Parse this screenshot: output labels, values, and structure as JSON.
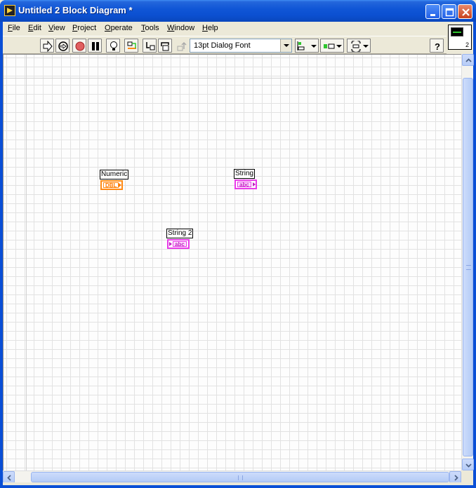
{
  "window": {
    "title": "Untitled 2 Block Diagram *",
    "controls": [
      "minimize",
      "maximize",
      "close"
    ]
  },
  "menubar": {
    "items": [
      {
        "key": "file",
        "underline": "F",
        "rest": "ile"
      },
      {
        "key": "edit",
        "underline": "E",
        "rest": "dit"
      },
      {
        "key": "view",
        "underline": "V",
        "rest": "iew"
      },
      {
        "key": "project",
        "underline": "P",
        "rest": "roject"
      },
      {
        "key": "operate",
        "underline": "O",
        "rest": "perate"
      },
      {
        "key": "tools",
        "underline": "T",
        "rest": "ools"
      },
      {
        "key": "window",
        "underline": "W",
        "rest": "indow"
      },
      {
        "key": "help",
        "underline": "H",
        "rest": "elp"
      }
    ]
  },
  "toolbar": {
    "font_select": "13pt Dialog Font"
  },
  "vi_icon": {
    "number": "2"
  },
  "diagram": {
    "nodes": [
      {
        "label": "Numeric",
        "terminal": "DBL",
        "kind": "dbl"
      },
      {
        "label": "String",
        "terminal": "abc",
        "kind": "str"
      },
      {
        "label": "String 2",
        "terminal": "abc",
        "kind": "str"
      }
    ]
  },
  "colors": {
    "title_bar": "#0a4fd6",
    "dbl_wire": "#ff8a15",
    "string_wire": "#e83be8",
    "canvas": "#fdfdfd"
  }
}
